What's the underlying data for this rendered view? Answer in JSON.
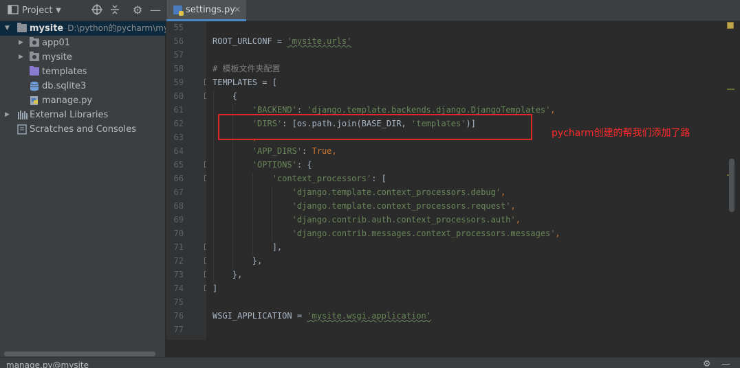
{
  "project_panel": {
    "title": "Project",
    "tree": [
      {
        "label": "mysite",
        "path": "D:\\python的pycharm\\mysi",
        "icon": "folder-icon",
        "expanded": true
      },
      {
        "label": "app01",
        "icon": "package-folder-icon"
      },
      {
        "label": "mysite",
        "icon": "package-folder-icon"
      },
      {
        "label": "templates",
        "icon": "templates-folder-icon"
      },
      {
        "label": "db.sqlite3",
        "icon": "database-icon"
      },
      {
        "label": "manage.py",
        "icon": "python-file-icon"
      },
      {
        "label": "External Libraries",
        "icon": "libraries-icon"
      },
      {
        "label": "Scratches and Consoles",
        "icon": "scratches-icon"
      }
    ]
  },
  "editor": {
    "tab_label": "settings.py",
    "line_numbers": [
      "55",
      "56",
      "57",
      "58",
      "59",
      "60",
      "61",
      "62",
      "63",
      "64",
      "65",
      "66",
      "67",
      "68",
      "69",
      "70",
      "71",
      "72",
      "73",
      "74",
      "75",
      "76",
      "77"
    ],
    "code": {
      "l56_a": "ROOT_URLCONF = ",
      "l56_b": "'mysite.urls'",
      "l58": "# 模板文件夹配置",
      "l59": "TEMPLATES = [",
      "l60": "    {",
      "l61_a": "        'BACKEND'",
      "l61_b": ": ",
      "l61_c": "'django.template.backends.django.DjangoTemplates'",
      "l61_d": ",",
      "l62_a": "        'DIRS'",
      "l62_b": ": [os.path.join(BASE_DIR, ",
      "l62_c": "'templates'",
      "l62_d": ")]",
      "l63": "        ,",
      "l64_a": "        'APP_DIRS'",
      "l64_b": ": ",
      "l64_c": "True",
      "l64_d": ",",
      "l65_a": "        'OPTIONS'",
      "l65_b": ": {",
      "l66_a": "            'context_processors'",
      "l66_b": ": [",
      "l67_a": "                'django.template.context_processors.debug'",
      "l67_b": ",",
      "l68_a": "                'django.template.context_processors.request'",
      "l68_b": ",",
      "l69_a": "                'django.contrib.auth.context_processors.auth'",
      "l69_b": ",",
      "l70_a": "                'django.contrib.messages.context_processors.messages'",
      "l70_b": ",",
      "l71": "            ],",
      "l72": "        },",
      "l73": "    },",
      "l74": "]",
      "l76_a": "WSGI_APPLICATION = ",
      "l76_b": "'mysite.wsgi.application'"
    },
    "annotation": "pycharm创建的帮我们添加了路"
  },
  "bottom_bar": {
    "title": "manage.py@mysite"
  },
  "colors": {
    "accent": "#4a88c7",
    "highlight_box": "#e0262b",
    "string": "#6a8759",
    "keyword": "#cc7832"
  }
}
